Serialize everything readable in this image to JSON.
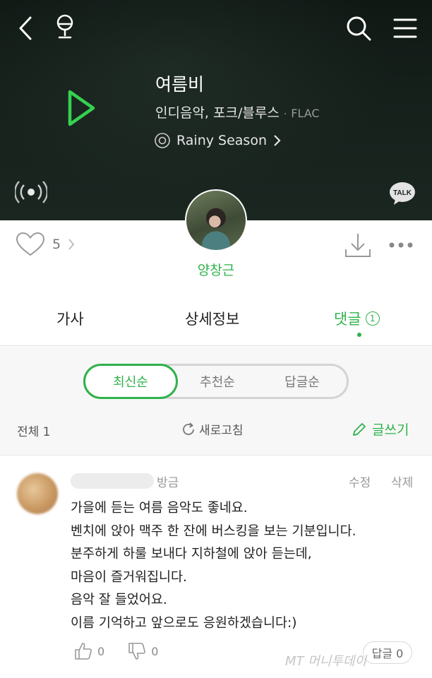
{
  "song": {
    "title": "여름비",
    "genre": "인디음악, 포크/블루스",
    "meta_separator": "·",
    "format": "FLAC",
    "album": "Rainy Season"
  },
  "artist": {
    "name": "양창근"
  },
  "talk_label": "TALK",
  "likes": {
    "count": "5"
  },
  "tabs": [
    {
      "label": "가사"
    },
    {
      "label": "상세정보"
    },
    {
      "label": "댓글",
      "badge": "1"
    }
  ],
  "sort": {
    "options": [
      "최신순",
      "추천순",
      "답글순"
    ],
    "selected": "최신순"
  },
  "comments_header": {
    "total": "전체 1",
    "refresh": "새로고침",
    "write": "글쓰기"
  },
  "comment": {
    "time": "방금",
    "edit": "수정",
    "delete": "삭제",
    "lines": [
      "가을에 듣는 여름 음악도 좋네요.",
      "벤치에 앉아 맥주 한 잔에 버스킹을 보는 기분입니다.",
      "분주하게 하룰 보내다 지하철에 앉아 듣는데,",
      "마음이 즐거워집니다.",
      "음악 잘 들었어요.",
      "이름 기억하고 앞으로도 응원하겠습니다:)"
    ],
    "up_count": "0",
    "down_count": "0",
    "reply_label": "답글 0"
  },
  "watermark": "MT 머니투데이",
  "colors": {
    "accent": "#2fb24a",
    "hero_bg": "#16201b"
  }
}
